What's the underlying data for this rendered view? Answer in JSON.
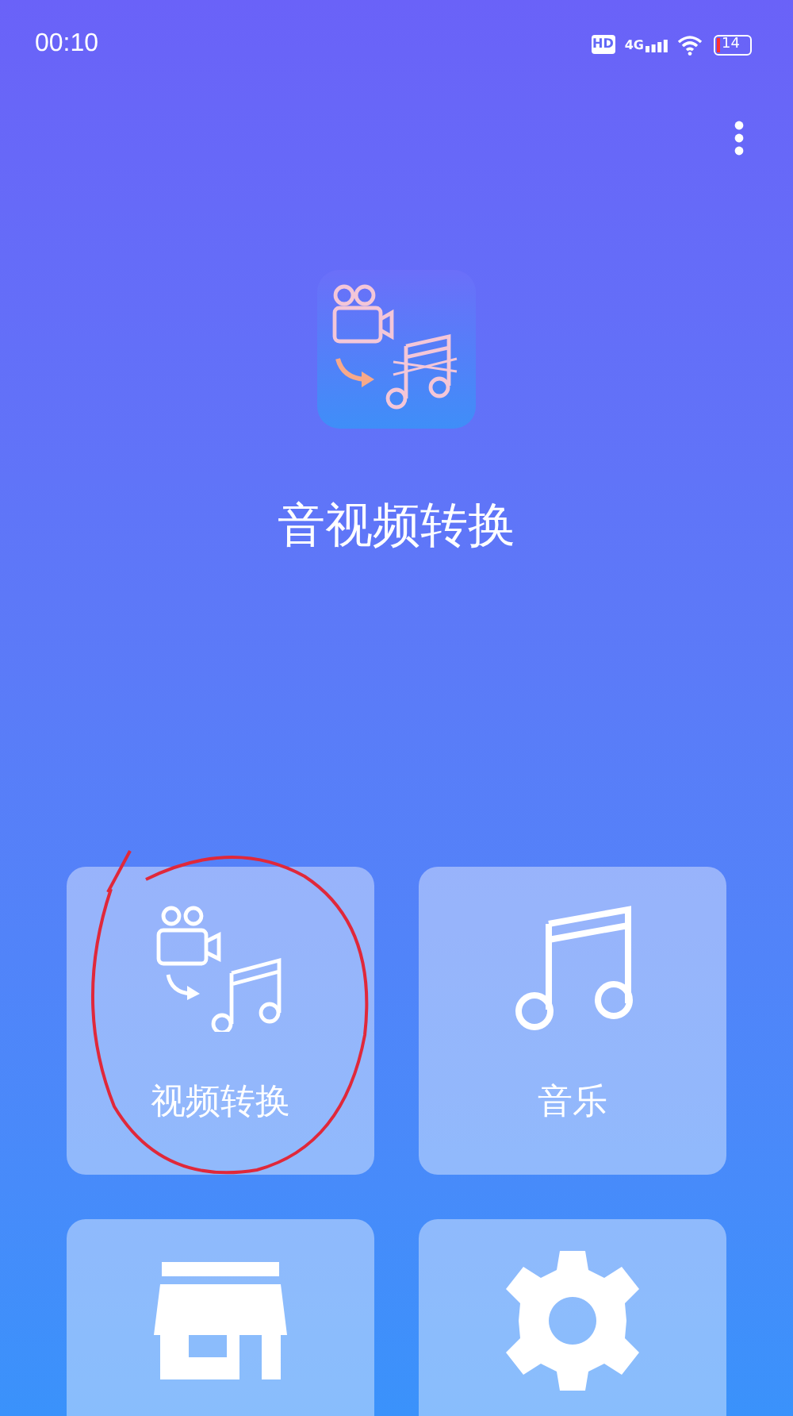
{
  "status_bar": {
    "time": "00:10",
    "hd_badge": "HD",
    "network": "4G",
    "battery": "14"
  },
  "app": {
    "title": "音视频转换"
  },
  "tiles": [
    {
      "kind": "video-convert",
      "label": "视频转换"
    },
    {
      "kind": "music",
      "label": "音乐"
    },
    {
      "kind": "store"
    },
    {
      "kind": "settings"
    }
  ]
}
